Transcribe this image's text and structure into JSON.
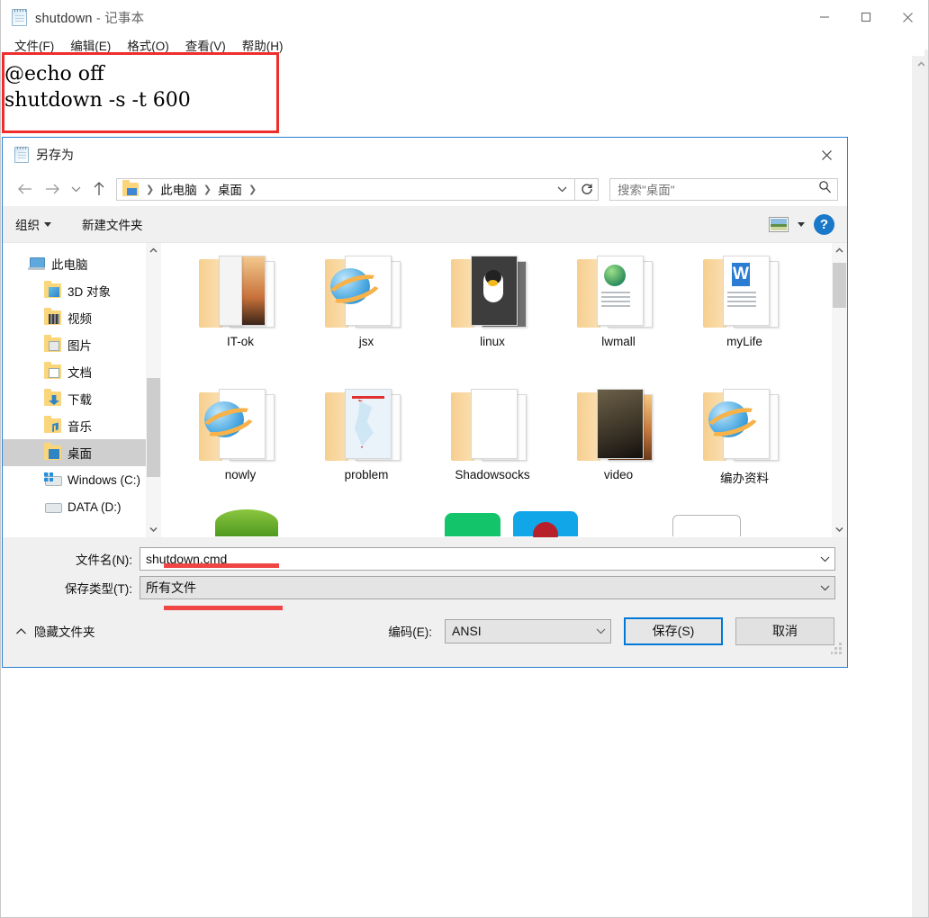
{
  "notepad": {
    "icon": "notepad-icon",
    "title_file": "shutdown",
    "title_sep": " - ",
    "title_app": "记事本",
    "menus": [
      "文件(F)",
      "编辑(E)",
      "格式(O)",
      "查看(V)",
      "帮助(H)"
    ],
    "content_line1": "@echo off",
    "content_line2": "shutdown -s -t 600",
    "window_buttons": {
      "minimize": "minimize-icon",
      "maximize": "maximize-icon",
      "close": "close-icon"
    }
  },
  "annotation": {
    "color": "#ef2d2d",
    "box_label": "red-highlight-box",
    "underline_filename": "red-underline",
    "underline_filetype": "red-underline"
  },
  "dialog": {
    "icon": "notepad-icon",
    "title": "另存为",
    "close_label": "close-icon",
    "nav": {
      "back": "back-arrow-icon",
      "forward": "forward-arrow-icon",
      "recent": "chevron-down-icon",
      "up": "up-arrow-icon",
      "breadcrumb": [
        "此电脑",
        "桌面"
      ],
      "breadcrumb_dropdown": "chevron-down-icon",
      "refresh": "refresh-icon"
    },
    "search": {
      "placeholder": "搜索\"桌面\"",
      "icon": "search-icon"
    },
    "commandbar": {
      "organize": "组织",
      "new_folder": "新建文件夹",
      "view_icon": "view-layout-icon",
      "view_caret": "chevron-down-icon",
      "help": "?"
    },
    "tree": [
      {
        "label": "此电脑",
        "icon": "computer-icon",
        "level": 1,
        "selected": false
      },
      {
        "label": "3D 对象",
        "icon": "folder-3d-icon",
        "level": 2,
        "selected": false
      },
      {
        "label": "视频",
        "icon": "folder-video-icon",
        "level": 2,
        "selected": false
      },
      {
        "label": "图片",
        "icon": "folder-pictures-icon",
        "level": 2,
        "selected": false
      },
      {
        "label": "文档",
        "icon": "folder-documents-icon",
        "level": 2,
        "selected": false
      },
      {
        "label": "下载",
        "icon": "folder-downloads-icon",
        "level": 2,
        "selected": false
      },
      {
        "label": "音乐",
        "icon": "folder-music-icon",
        "level": 2,
        "selected": false
      },
      {
        "label": "桌面",
        "icon": "folder-desktop-icon",
        "level": 2,
        "selected": true
      },
      {
        "label": "Windows (C:)",
        "icon": "windows-drive-icon",
        "level": 2,
        "selected": false
      },
      {
        "label": "DATA (D:)",
        "icon": "drive-icon",
        "level": 2,
        "selected": false
      }
    ],
    "files": [
      {
        "name": "IT-ok",
        "thumb": "photo-sunset"
      },
      {
        "name": "jsx",
        "thumb": "ie-browser"
      },
      {
        "name": "linux",
        "thumb": "tux-penguin"
      },
      {
        "name": "lwmall",
        "thumb": "document-globe"
      },
      {
        "name": "myLife",
        "thumb": "document-word"
      },
      {
        "name": "nowly",
        "thumb": "ie-browser"
      },
      {
        "name": "problem",
        "thumb": "map-chart"
      },
      {
        "name": "Shadowsocks",
        "thumb": "blank-pages"
      },
      {
        "name": "video",
        "thumb": "photo-soldier"
      },
      {
        "name": "编办资料",
        "thumb": "ie-browser"
      }
    ],
    "form": {
      "filename_label": "文件名(N):",
      "filename_value": "shutdown.cmd",
      "filename_caret": "chevron-down-icon",
      "filetype_label": "保存类型(T):",
      "filetype_value": "所有文件",
      "filetype_caret": "chevron-down-icon"
    },
    "footer": {
      "hide_folders_caret": "chevron-up-icon",
      "hide_folders": "隐藏文件夹",
      "encoding_label": "编码(E):",
      "encoding_value": "ANSI",
      "encoding_caret": "chevron-down-icon",
      "save": "保存(S)",
      "cancel": "取消",
      "resize_grip": "resize-grip-icon"
    }
  }
}
